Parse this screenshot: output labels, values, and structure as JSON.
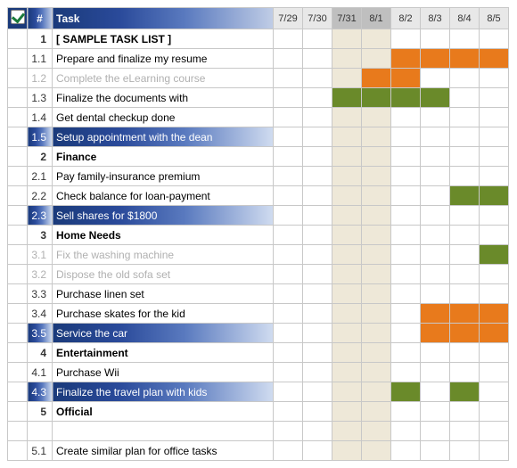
{
  "header": {
    "check_label": "✓",
    "num_label": "#",
    "task_label": "Task",
    "dates": [
      "7/29",
      "7/30",
      "7/31",
      "8/1",
      "8/2",
      "8/3",
      "8/4",
      "8/5"
    ],
    "dark_date_indices": [
      2,
      3
    ]
  },
  "weekend_indices": [
    2,
    3
  ],
  "rows": [
    {
      "num": "1",
      "task": "[ SAMPLE TASK LIST ]",
      "type": "group",
      "bars": []
    },
    {
      "num": "1.1",
      "task": "Prepare and finalize my resume",
      "type": "sub",
      "bars": [
        {
          "start": 4,
          "end": 7,
          "color": "orange"
        }
      ]
    },
    {
      "num": "1.2",
      "task": "Complete the eLearning course",
      "type": "sub",
      "completed": true,
      "bars": [
        {
          "start": 3,
          "end": 4,
          "color": "orange"
        }
      ]
    },
    {
      "num": "1.3",
      "task": "Finalize the documents with",
      "type": "sub",
      "bars": [
        {
          "start": 2,
          "end": 5,
          "color": "green"
        }
      ]
    },
    {
      "num": "1.4",
      "task": "Get dental checkup done",
      "type": "sub",
      "bars": []
    },
    {
      "num": "1.5",
      "task": "Setup appointment with the dean",
      "type": "sub",
      "highlight": true,
      "bars": []
    },
    {
      "num": "2",
      "task": "Finance",
      "type": "group",
      "bars": []
    },
    {
      "num": "2.1",
      "task": "Pay family-insurance premium",
      "type": "sub",
      "bars": []
    },
    {
      "num": "2.2",
      "task": "Check balance for loan-payment",
      "type": "sub",
      "bars": [
        {
          "start": 6,
          "end": 7,
          "color": "green"
        }
      ]
    },
    {
      "num": "2.3",
      "task": "Sell shares for $1800",
      "type": "sub",
      "highlight": true,
      "bars": []
    },
    {
      "num": "3",
      "task": "Home Needs",
      "type": "group",
      "bars": []
    },
    {
      "num": "3.1",
      "task": "Fix the washing machine",
      "type": "sub",
      "completed": true,
      "bars": [
        {
          "start": 7,
          "end": 7,
          "color": "green"
        }
      ]
    },
    {
      "num": "3.2",
      "task": "Dispose the old sofa set",
      "type": "sub",
      "completed": true,
      "bars": []
    },
    {
      "num": "3.3",
      "task": "Purchase linen set",
      "type": "sub",
      "bars": []
    },
    {
      "num": "3.4",
      "task": "Purchase skates for the kid",
      "type": "sub",
      "bars": [
        {
          "start": 5,
          "end": 7,
          "color": "orange"
        }
      ]
    },
    {
      "num": "3.5",
      "task": "Service the car",
      "type": "sub",
      "highlight": true,
      "bars": [
        {
          "start": 5,
          "end": 7,
          "color": "orange"
        }
      ]
    },
    {
      "num": "4",
      "task": "Entertainment",
      "type": "group",
      "bars": []
    },
    {
      "num": "4.1",
      "task": "Purchase Wii",
      "type": "sub",
      "bars": []
    },
    {
      "num": "4.3",
      "task": "Finalize the travel plan with kids",
      "type": "sub",
      "highlight": true,
      "bars": [
        {
          "start": 4,
          "end": 4,
          "color": "green"
        },
        {
          "start": 6,
          "end": 6,
          "color": "green"
        }
      ]
    },
    {
      "num": "5",
      "task": "Official",
      "type": "group",
      "bars": []
    },
    {
      "num": "",
      "task": "",
      "type": "blank",
      "bars": []
    },
    {
      "num": "5.1",
      "task": "Create similar plan for office tasks",
      "type": "sub",
      "bars": []
    }
  ]
}
